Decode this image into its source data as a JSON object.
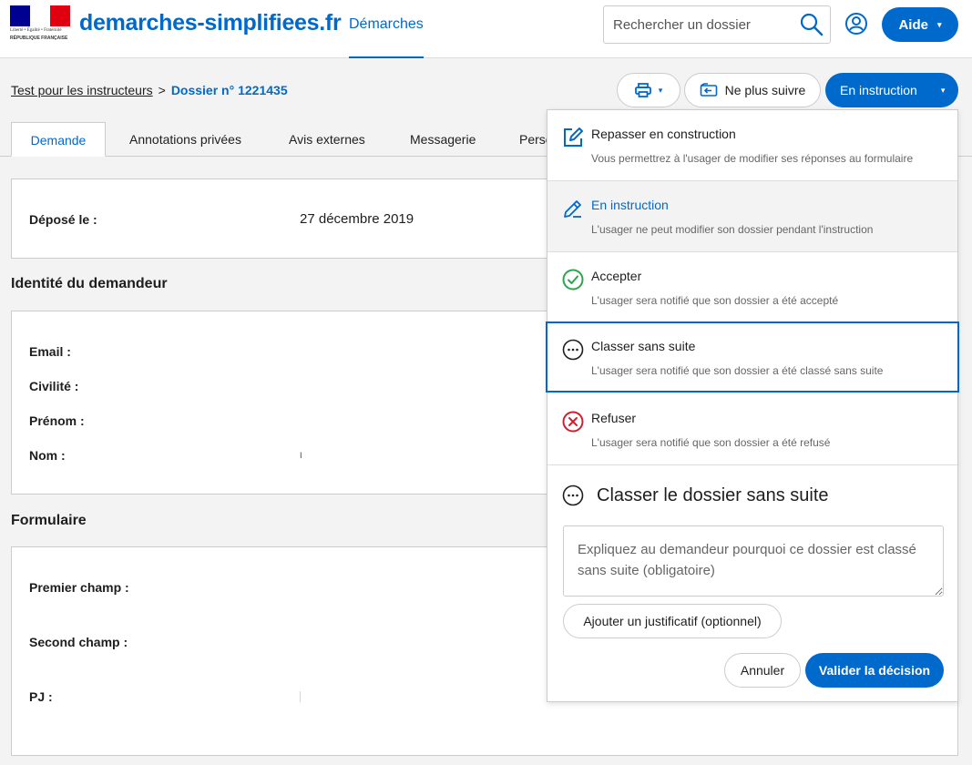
{
  "header": {
    "logo_line1": "Liberté • Égalité • Fraternité",
    "logo_line2": "RÉPUBLIQUE FRANÇAISE",
    "brand": "demarches-simplifiees.fr",
    "nav_demarches": "Démarches",
    "search_placeholder": "Rechercher un dossier",
    "help_label": "Aide",
    "caret": "▾"
  },
  "subheader": {
    "breadcrumb_procedure": "Test pour les instructeurs",
    "breadcrumb_sep": ">",
    "breadcrumb_dossier": "Dossier n° 1221435",
    "print_caret": "▾",
    "unfollow_label": "Ne plus suivre",
    "state_label": "En instruction",
    "state_caret": "▾"
  },
  "tabs": [
    {
      "label": "Demande"
    },
    {
      "label": "Annotations privées"
    },
    {
      "label": "Avis externes"
    },
    {
      "label": "Messagerie"
    },
    {
      "label": "Perso"
    }
  ],
  "main": {
    "deposit_label": "Déposé le :",
    "deposit_value": "27 décembre 2019",
    "identity_title": "Identité du demandeur",
    "email_label": "Email :",
    "civility_label": "Civilité :",
    "firstname_label": "Prénom :",
    "lastname_label": "Nom :",
    "lastname_value": "ι",
    "form_title": "Formulaire",
    "field1_label": "Premier champ :",
    "field2_label": "Second champ :",
    "pj_label": "PJ :"
  },
  "panel": {
    "options": [
      {
        "title": "Repasser en construction",
        "desc": "Vous permettrez à l'usager de modifier ses réponses au formulaire",
        "icon": "edit-icon"
      },
      {
        "title": "En instruction",
        "desc": "L'usager ne peut modifier son dossier pendant l'instruction",
        "icon": "pencil-icon"
      },
      {
        "title": "Accepter",
        "desc": "L'usager sera notifié que son dossier a été accepté",
        "icon": "check-circle-icon"
      },
      {
        "title": "Classer sans suite",
        "desc": "L'usager sera notifié que son dossier a été classé sans suite",
        "icon": "ellipsis-circle-icon"
      },
      {
        "title": "Refuser",
        "desc": "L'usager sera notifié que son dossier a été refusé",
        "icon": "cross-circle-icon"
      }
    ],
    "decision_title": "Classer le dossier sans suite",
    "motif_placeholder": "Expliquez au demandeur pourquoi ce dossier est classé sans suite (obligatoire)",
    "attach_label": "Ajouter un justificatif (optionnel)",
    "cancel_label": "Annuler",
    "validate_label": "Valider la décision"
  },
  "colors": {
    "primary": "#0069cc",
    "success": "#2ea44f",
    "danger": "#d0202e"
  }
}
